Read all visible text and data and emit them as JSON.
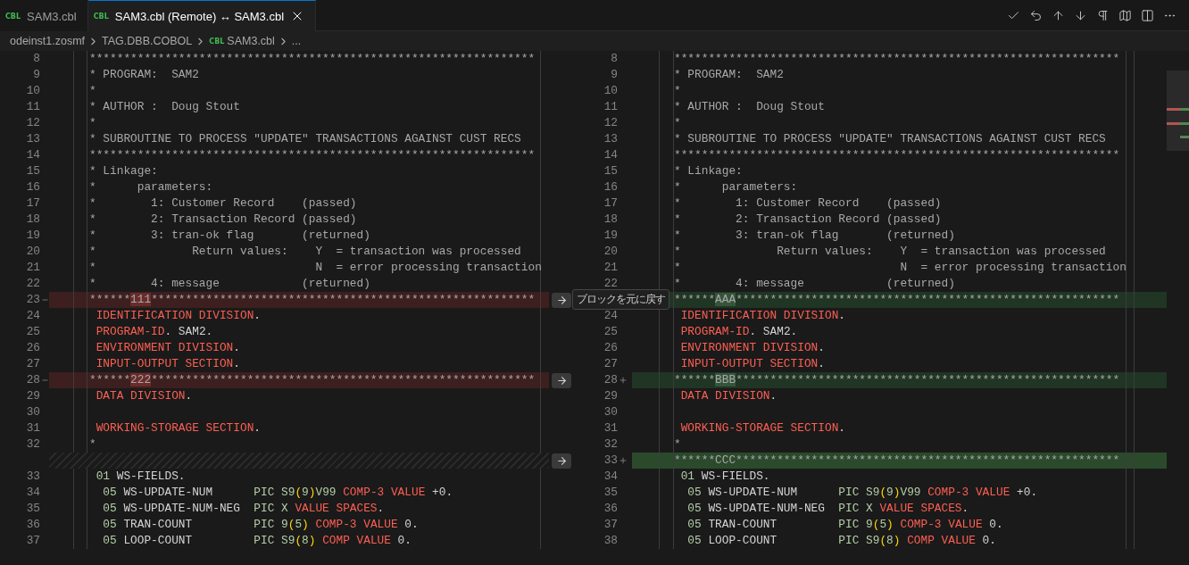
{
  "tabs": [
    {
      "file_type": "CBL",
      "label": "SAM3.cbl",
      "selected": false,
      "closable": false
    },
    {
      "file_type": "CBL",
      "label": "SAM3.cbl (Remote) ↔ SAM3.cbl",
      "selected": true,
      "closable": true
    }
  ],
  "breadcrumbs": [
    {
      "label": "odeinst1.zosmf"
    },
    {
      "label": "TAG.DBB.COBOL"
    },
    {
      "file_type": "CBL",
      "label": "SAM3.cbl"
    },
    {
      "label": "..."
    }
  ],
  "left": [
    {
      "kind": "line",
      "number": "8",
      "changed": false,
      "tokens": [
        {
          "kind": "comment",
          "text": "*****************************************************************"
        }
      ]
    },
    {
      "kind": "line",
      "number": "9",
      "changed": false,
      "tokens": [
        {
          "kind": "comment",
          "text": "* PROGRAM:  SAM2"
        }
      ]
    },
    {
      "kind": "line",
      "number": "10",
      "changed": false,
      "tokens": [
        {
          "kind": "comment",
          "text": "*"
        }
      ]
    },
    {
      "kind": "line",
      "number": "11",
      "changed": false,
      "tokens": [
        {
          "kind": "comment",
          "text": "* AUTHOR :  Doug Stout"
        }
      ]
    },
    {
      "kind": "line",
      "number": "12",
      "changed": false,
      "tokens": [
        {
          "kind": "comment",
          "text": "*"
        }
      ]
    },
    {
      "kind": "line",
      "number": "13",
      "changed": false,
      "tokens": [
        {
          "kind": "comment",
          "text": "* SUBROUTINE TO PROCESS \"UPDATE\" TRANSACTIONS AGAINST CUST RECS"
        }
      ]
    },
    {
      "kind": "line",
      "number": "14",
      "changed": false,
      "tokens": [
        {
          "kind": "comment",
          "text": "*****************************************************************"
        }
      ]
    },
    {
      "kind": "line",
      "number": "15",
      "changed": false,
      "tokens": [
        {
          "kind": "comment",
          "text": "* Linkage:"
        }
      ]
    },
    {
      "kind": "line",
      "number": "16",
      "changed": false,
      "tokens": [
        {
          "kind": "comment",
          "text": "*      parameters:"
        }
      ]
    },
    {
      "kind": "line",
      "number": "17",
      "changed": false,
      "tokens": [
        {
          "kind": "comment",
          "text": "*        1: Customer Record    (passed)"
        }
      ]
    },
    {
      "kind": "line",
      "number": "18",
      "changed": false,
      "tokens": [
        {
          "kind": "comment",
          "text": "*        2: Transaction Record (passed)"
        }
      ]
    },
    {
      "kind": "line",
      "number": "19",
      "changed": false,
      "tokens": [
        {
          "kind": "comment",
          "text": "*        3: tran-ok flag       (returned)"
        }
      ]
    },
    {
      "kind": "line",
      "number": "20",
      "changed": false,
      "tokens": [
        {
          "kind": "comment",
          "text": "*              Return values:    Y  = transaction was processed"
        }
      ]
    },
    {
      "kind": "line",
      "number": "21",
      "changed": false,
      "tokens": [
        {
          "kind": "comment",
          "text": "*                                N  = error processing transaction"
        }
      ]
    },
    {
      "kind": "line",
      "number": "22",
      "changed": false,
      "tokens": [
        {
          "kind": "comment",
          "text": "*        4: message            (returned)"
        }
      ]
    },
    {
      "kind": "line",
      "number": "23",
      "changed": true,
      "tooltip": "ブロックを元に戻す",
      "tokens": [
        {
          "kind": "comment",
          "text": "******"
        },
        {
          "kind": "changed",
          "text": "111"
        },
        {
          "kind": "comment",
          "text": "********************************************************"
        }
      ]
    },
    {
      "kind": "line",
      "number": "24",
      "changed": false,
      "tokens": [
        {
          "kind": "keyword",
          "text": " IDENTIFICATION DIVISION"
        },
        {
          "kind": "plain",
          "text": "."
        }
      ]
    },
    {
      "kind": "line",
      "number": "25",
      "changed": false,
      "tokens": [
        {
          "kind": "keyword",
          "text": " PROGRAM-ID"
        },
        {
          "kind": "plain",
          "text": ". SAM2."
        }
      ]
    },
    {
      "kind": "line",
      "number": "26",
      "changed": false,
      "tokens": [
        {
          "kind": "keyword",
          "text": " ENVIRONMENT DIVISION"
        },
        {
          "kind": "plain",
          "text": "."
        }
      ]
    },
    {
      "kind": "line",
      "number": "27",
      "changed": false,
      "tokens": [
        {
          "kind": "keyword",
          "text": " INPUT-OUTPUT SECTION"
        },
        {
          "kind": "plain",
          "text": "."
        }
      ]
    },
    {
      "kind": "line",
      "number": "28",
      "changed": true,
      "tokens": [
        {
          "kind": "comment",
          "text": "******"
        },
        {
          "kind": "changed",
          "text": "222"
        },
        {
          "kind": "comment",
          "text": "********************************************************"
        }
      ]
    },
    {
      "kind": "line",
      "number": "29",
      "changed": false,
      "tokens": [
        {
          "kind": "keyword",
          "text": " DATA DIVISION"
        },
        {
          "kind": "plain",
          "text": "."
        }
      ]
    },
    {
      "kind": "line",
      "number": "30",
      "changed": false
    },
    {
      "kind": "line",
      "number": "31",
      "changed": false,
      "tokens": [
        {
          "kind": "keyword",
          "text": " WORKING-STORAGE SECTION"
        },
        {
          "kind": "plain",
          "text": "."
        }
      ]
    },
    {
      "kind": "line",
      "number": "32",
      "changed": false,
      "tokens": [
        {
          "kind": "comment",
          "text": "*"
        }
      ]
    },
    {
      "kind": "filler"
    },
    {
      "kind": "line",
      "number": "33",
      "changed": false,
      "tokens": [
        {
          "kind": "number",
          "text": " 01"
        },
        {
          "kind": "plain",
          "text": " WS-FIELDS."
        }
      ]
    },
    {
      "kind": "line",
      "number": "34",
      "changed": false,
      "tokens": [
        {
          "kind": "number",
          "text": "  05"
        },
        {
          "kind": "plain",
          "text": " WS-UPDATE-NUM      "
        },
        {
          "kind": "number",
          "text": "PIC S9"
        },
        {
          "kind": "paren",
          "text": "("
        },
        {
          "kind": "number",
          "text": "9"
        },
        {
          "kind": "paren",
          "text": ")"
        },
        {
          "kind": "number",
          "text": "V99"
        },
        {
          "kind": "keyword",
          "text": " COMP-3 VALUE"
        },
        {
          "kind": "plain",
          "text": " +0."
        }
      ]
    },
    {
      "kind": "line",
      "number": "35",
      "changed": false,
      "tokens": [
        {
          "kind": "number",
          "text": "  05"
        },
        {
          "kind": "plain",
          "text": " WS-UPDATE-NUM-NEG  "
        },
        {
          "kind": "number",
          "text": "PIC X"
        },
        {
          "kind": "keyword",
          "text": " VALUE SPACES"
        },
        {
          "kind": "plain",
          "text": "."
        }
      ]
    },
    {
      "kind": "line",
      "number": "36",
      "changed": false,
      "tokens": [
        {
          "kind": "number",
          "text": "  05"
        },
        {
          "kind": "plain",
          "text": " TRAN-COUNT         "
        },
        {
          "kind": "number",
          "text": "PIC 9"
        },
        {
          "kind": "paren",
          "text": "("
        },
        {
          "kind": "number",
          "text": "5"
        },
        {
          "kind": "paren",
          "text": ")"
        },
        {
          "kind": "keyword",
          "text": " COMP-3 VALUE"
        },
        {
          "kind": "plain",
          "text": " 0."
        }
      ]
    },
    {
      "kind": "line",
      "number": "37",
      "changed": false,
      "tokens": [
        {
          "kind": "number",
          "text": "  05"
        },
        {
          "kind": "plain",
          "text": " LOOP-COUNT         "
        },
        {
          "kind": "number",
          "text": "PIC S9"
        },
        {
          "kind": "paren",
          "text": "("
        },
        {
          "kind": "number",
          "text": "8"
        },
        {
          "kind": "paren",
          "text": ")"
        },
        {
          "kind": "keyword",
          "text": " COMP VALUE"
        },
        {
          "kind": "plain",
          "text": " 0."
        }
      ]
    }
  ],
  "right": [
    {
      "kind": "line",
      "number": "8",
      "changed": false,
      "tokens": [
        {
          "kind": "comment",
          "text": "*****************************************************************"
        }
      ]
    },
    {
      "kind": "line",
      "number": "9",
      "changed": false,
      "tokens": [
        {
          "kind": "comment",
          "text": "* PROGRAM:  SAM2"
        }
      ]
    },
    {
      "kind": "line",
      "number": "10",
      "changed": false,
      "tokens": [
        {
          "kind": "comment",
          "text": "*"
        }
      ]
    },
    {
      "kind": "line",
      "number": "11",
      "changed": false,
      "tokens": [
        {
          "kind": "comment",
          "text": "* AUTHOR :  Doug Stout"
        }
      ]
    },
    {
      "kind": "line",
      "number": "12",
      "changed": false,
      "tokens": [
        {
          "kind": "comment",
          "text": "*"
        }
      ]
    },
    {
      "kind": "line",
      "number": "13",
      "changed": false,
      "tokens": [
        {
          "kind": "comment",
          "text": "* SUBROUTINE TO PROCESS \"UPDATE\" TRANSACTIONS AGAINST CUST RECS"
        }
      ]
    },
    {
      "kind": "line",
      "number": "14",
      "changed": false,
      "tokens": [
        {
          "kind": "comment",
          "text": "*****************************************************************"
        }
      ]
    },
    {
      "kind": "line",
      "number": "15",
      "changed": false,
      "tokens": [
        {
          "kind": "comment",
          "text": "* Linkage:"
        }
      ]
    },
    {
      "kind": "line",
      "number": "16",
      "changed": false,
      "tokens": [
        {
          "kind": "comment",
          "text": "*      parameters:"
        }
      ]
    },
    {
      "kind": "line",
      "number": "17",
      "changed": false,
      "tokens": [
        {
          "kind": "comment",
          "text": "*        1: Customer Record    (passed)"
        }
      ]
    },
    {
      "kind": "line",
      "number": "18",
      "changed": false,
      "tokens": [
        {
          "kind": "comment",
          "text": "*        2: Transaction Record (passed)"
        }
      ]
    },
    {
      "kind": "line",
      "number": "19",
      "changed": false,
      "tokens": [
        {
          "kind": "comment",
          "text": "*        3: tran-ok flag       (returned)"
        }
      ]
    },
    {
      "kind": "line",
      "number": "20",
      "changed": false,
      "tokens": [
        {
          "kind": "comment",
          "text": "*              Return values:    Y  = transaction was processed"
        }
      ]
    },
    {
      "kind": "line",
      "number": "21",
      "changed": false,
      "tokens": [
        {
          "kind": "comment",
          "text": "*                                N  = error processing transaction"
        }
      ]
    },
    {
      "kind": "line",
      "number": "22",
      "changed": false,
      "tokens": [
        {
          "kind": "comment",
          "text": "*        4: message            (returned)"
        }
      ]
    },
    {
      "kind": "line",
      "changed": true,
      "tokens": [
        {
          "kind": "comment",
          "text": "******"
        },
        {
          "kind": "changed",
          "text": "AAA"
        },
        {
          "kind": "comment",
          "text": "********************************************************"
        }
      ]
    },
    {
      "kind": "line",
      "number": "24",
      "changed": false,
      "tokens": [
        {
          "kind": "keyword",
          "text": " IDENTIFICATION DIVISION"
        },
        {
          "kind": "plain",
          "text": "."
        }
      ]
    },
    {
      "kind": "line",
      "number": "25",
      "changed": false,
      "tokens": [
        {
          "kind": "keyword",
          "text": " PROGRAM-ID"
        },
        {
          "kind": "plain",
          "text": ". SAM2."
        }
      ]
    },
    {
      "kind": "line",
      "number": "26",
      "changed": false,
      "tokens": [
        {
          "kind": "keyword",
          "text": " ENVIRONMENT DIVISION"
        },
        {
          "kind": "plain",
          "text": "."
        }
      ]
    },
    {
      "kind": "line",
      "number": "27",
      "changed": false,
      "tokens": [
        {
          "kind": "keyword",
          "text": " INPUT-OUTPUT SECTION"
        },
        {
          "kind": "plain",
          "text": "."
        }
      ]
    },
    {
      "kind": "line",
      "number": "28",
      "changed": true,
      "tokens": [
        {
          "kind": "comment",
          "text": "******"
        },
        {
          "kind": "changed",
          "text": "BBB"
        },
        {
          "kind": "comment",
          "text": "********************************************************"
        }
      ]
    },
    {
      "kind": "line",
      "number": "29",
      "changed": false,
      "tokens": [
        {
          "kind": "keyword",
          "text": " DATA DIVISION"
        },
        {
          "kind": "plain",
          "text": "."
        }
      ]
    },
    {
      "kind": "line",
      "number": "30",
      "changed": false
    },
    {
      "kind": "line",
      "number": "31",
      "changed": false,
      "tokens": [
        {
          "kind": "keyword",
          "text": " WORKING-STORAGE SECTION"
        },
        {
          "kind": "plain",
          "text": "."
        }
      ]
    },
    {
      "kind": "line",
      "number": "32",
      "changed": false,
      "tokens": [
        {
          "kind": "comment",
          "text": "*"
        }
      ]
    },
    {
      "kind": "inserted",
      "number": "33",
      "changed": true,
      "tokens": [
        {
          "kind": "comment",
          "text": "******CCC********************************************************"
        }
      ]
    },
    {
      "kind": "line",
      "number": "34",
      "changed": false,
      "tokens": [
        {
          "kind": "number",
          "text": " 01"
        },
        {
          "kind": "plain",
          "text": " WS-FIELDS."
        }
      ]
    },
    {
      "kind": "line",
      "number": "35",
      "changed": false,
      "tokens": [
        {
          "kind": "number",
          "text": "  05"
        },
        {
          "kind": "plain",
          "text": " WS-UPDATE-NUM      "
        },
        {
          "kind": "number",
          "text": "PIC S9"
        },
        {
          "kind": "paren",
          "text": "("
        },
        {
          "kind": "number",
          "text": "9"
        },
        {
          "kind": "paren",
          "text": ")"
        },
        {
          "kind": "number",
          "text": "V99"
        },
        {
          "kind": "keyword",
          "text": " COMP-3 VALUE"
        },
        {
          "kind": "plain",
          "text": " +0."
        }
      ]
    },
    {
      "kind": "line",
      "number": "36",
      "changed": false,
      "tokens": [
        {
          "kind": "number",
          "text": "  05"
        },
        {
          "kind": "plain",
          "text": " WS-UPDATE-NUM-NEG  "
        },
        {
          "kind": "number",
          "text": "PIC X"
        },
        {
          "kind": "keyword",
          "text": " VALUE SPACES"
        },
        {
          "kind": "plain",
          "text": "."
        }
      ]
    },
    {
      "kind": "line",
      "number": "37",
      "changed": false,
      "tokens": [
        {
          "kind": "number",
          "text": "  05"
        },
        {
          "kind": "plain",
          "text": " TRAN-COUNT         "
        },
        {
          "kind": "number",
          "text": "PIC 9"
        },
        {
          "kind": "paren",
          "text": "("
        },
        {
          "kind": "number",
          "text": "5"
        },
        {
          "kind": "paren",
          "text": ")"
        },
        {
          "kind": "keyword",
          "text": " COMP-3 VALUE"
        },
        {
          "kind": "plain",
          "text": " 0."
        }
      ]
    },
    {
      "kind": "line",
      "number": "38",
      "changed": false,
      "tokens": [
        {
          "kind": "number",
          "text": "  05"
        },
        {
          "kind": "plain",
          "text": " LOOP-COUNT         "
        },
        {
          "kind": "number",
          "text": "PIC S9"
        },
        {
          "kind": "paren",
          "text": "("
        },
        {
          "kind": "number",
          "text": "8"
        },
        {
          "kind": "paren",
          "text": ")"
        },
        {
          "kind": "keyword",
          "text": " COMP VALUE"
        },
        {
          "kind": "plain",
          "text": " 0."
        }
      ]
    }
  ]
}
